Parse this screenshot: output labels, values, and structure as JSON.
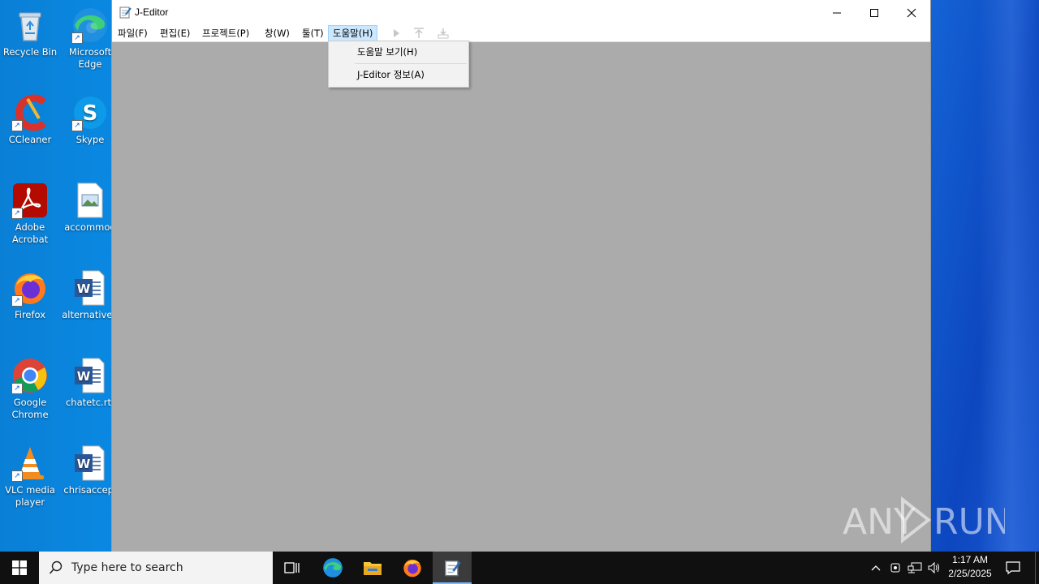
{
  "desktop": {
    "icons": [
      {
        "label": "Recycle Bin"
      },
      {
        "label": "Microsoft Edge"
      },
      {
        "label": "CCleaner"
      },
      {
        "label": "Skype"
      },
      {
        "label": "Adobe Acrobat"
      },
      {
        "label": "accommod"
      },
      {
        "label": "Firefox"
      },
      {
        "label": "alternativeu"
      },
      {
        "label": "Google Chrome"
      },
      {
        "label": "chatetc.rtf"
      },
      {
        "label": "VLC media player"
      },
      {
        "label": "chrisaccep."
      }
    ]
  },
  "window": {
    "title": "J-Editor",
    "menu": [
      "파일(F)",
      "편집(E)",
      "프로젝트(P)",
      "창(W)",
      "툴(T)",
      "도움말(H)"
    ],
    "active_menu": "도움말(H)",
    "dropdown": [
      "도움말 보기(H)",
      "J-Editor 정보(A)"
    ]
  },
  "taskbar": {
    "search_placeholder": "Type here to search",
    "time": "1:17 AM",
    "date": "2/25/2025"
  },
  "watermark": {
    "text_left": "ANY",
    "text_right": "RUN"
  },
  "colors": {
    "desktop_bg": "#0a8ce6",
    "client_bg": "#ababab",
    "menu_highlight": "#cce8ff",
    "taskbar_bg": "#101010"
  }
}
